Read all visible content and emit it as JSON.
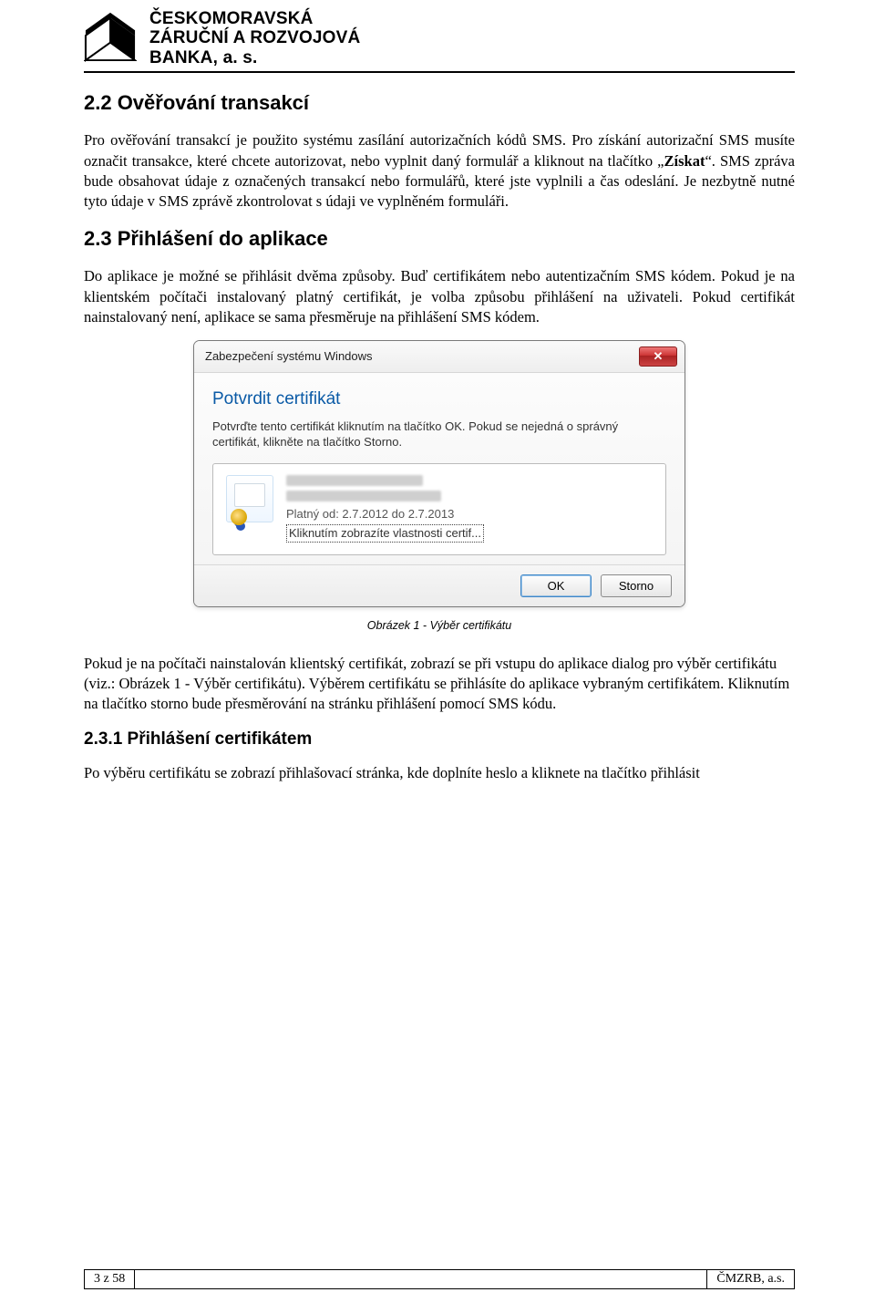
{
  "header": {
    "bank_name": "ČESKOMORAVSKÁ\nZÁRUČNÍ A ROZVOJOVÁ\nBANKA, a. s."
  },
  "section_2_2": {
    "title": "2.2  Ověřování transakcí",
    "para": "Pro ověřování transakcí je použito systému zasílání autorizačních kódů SMS. Pro získání autorizační SMS musíte označit transakce, které chcete autorizovat, nebo vyplnit daný formulář a kliknout na tlačítko „Získat“. SMS zpráva bude obsahovat údaje z označených transakcí nebo formulářů, které jste vyplnili a čas odeslání. Je nezbytně nutné tyto údaje v SMS zprávě zkontrolovat s údaji ve vyplněném formuláři.",
    "bold_word": "Získat"
  },
  "section_2_3": {
    "title": "2.3  Přihlášení do aplikace",
    "para": "Do aplikace je možné se přihlásit dvěma způsoby. Buď certifikátem nebo autentizačním SMS kódem. Pokud je na klientském počítači instalovaný platný certifikát, je volba způsobu přihlášení na uživateli. Pokud certifikát nainstalovaný není, aplikace se sama přesměruje na přihlášení SMS kódem."
  },
  "dialog": {
    "window_title": "Zabezpečení systému Windows",
    "heading": "Potvrdit certifikát",
    "text": "Potvrďte tento certifikát kliknutím na tlačítko OK. Pokud se nejedná o správný certifikát, klikněte na tlačítko Storno.",
    "valid_from": "Platný od: 2.7.2012 do 2.7.2013",
    "details_link": "Kliknutím zobrazíte vlastnosti certif...",
    "ok": "OK",
    "cancel": "Storno",
    "close_glyph": "✕"
  },
  "caption": "Obrázek 1 - Výběr certifikátu",
  "para_after": "Pokud je na počítači nainstalován klientský certifikát, zobrazí se při vstupu do aplikace dialog pro výběr certifikátu (viz.: Obrázek 1 - Výběr certifikátu). Výběrem certifikátu se přihlásíte do aplikace vybraným certifikátem. Kliknutím na tlačítko storno bude přesměrování na stránku přihlášení pomocí SMS kódu.",
  "section_2_3_1": {
    "title": "2.3.1  Přihlášení certifikátem",
    "para": "Po výběru certifikátu se zobrazí přihlašovací stránka, kde doplníte heslo a kliknete na tlačítko přihlásit"
  },
  "footer": {
    "page": "3 z 58",
    "company": "ČMZRB, a.s."
  }
}
